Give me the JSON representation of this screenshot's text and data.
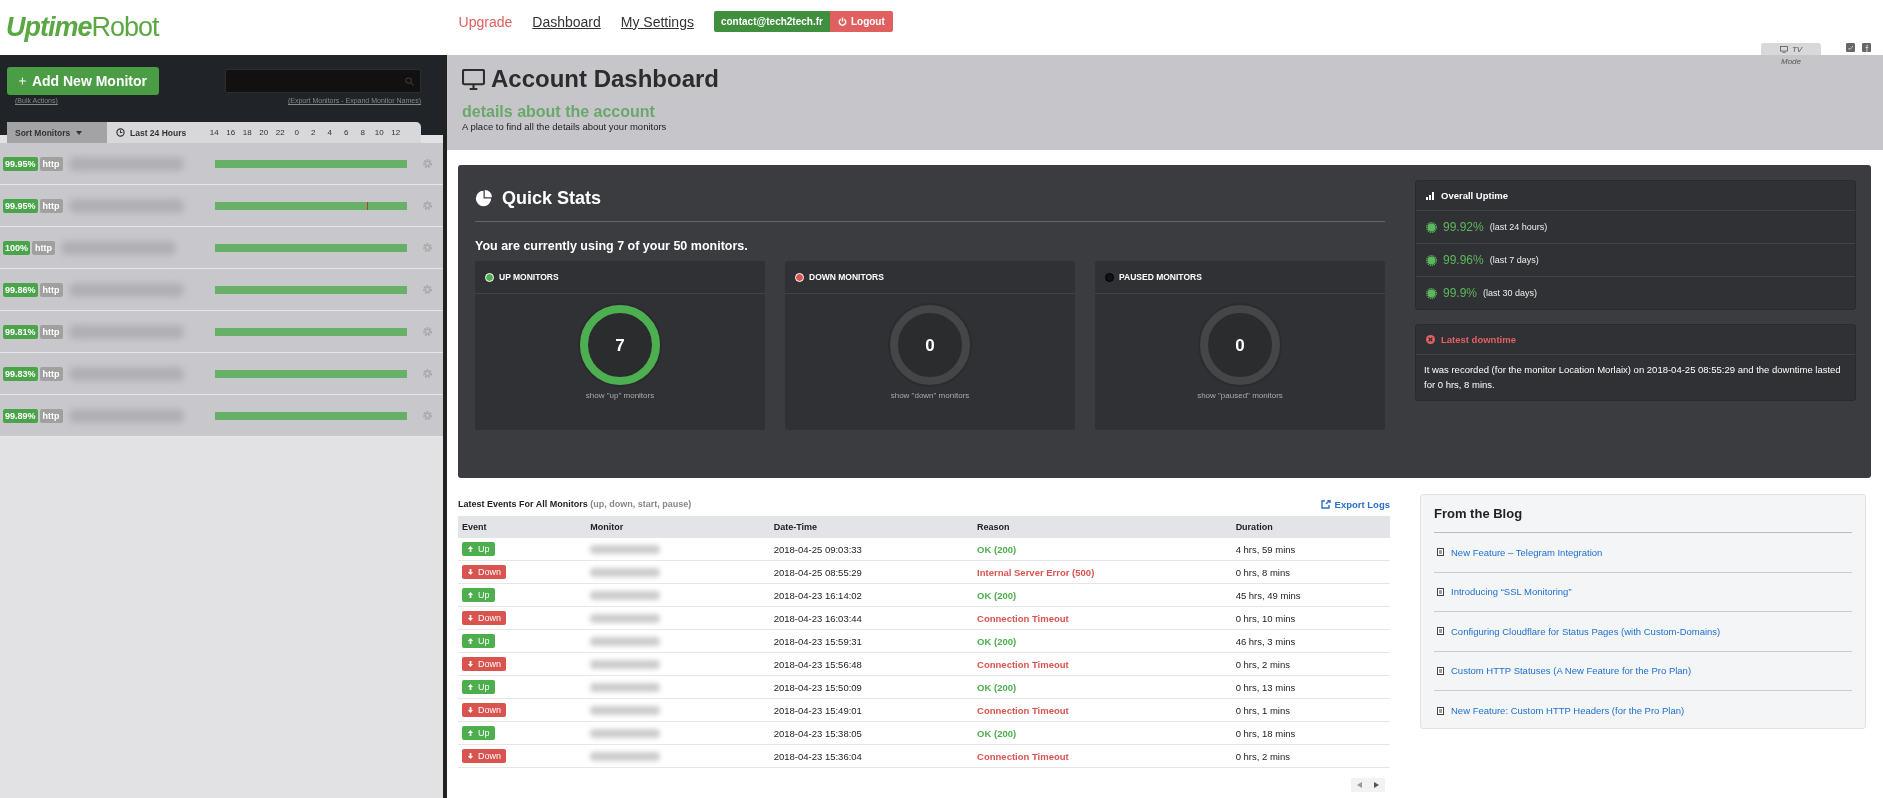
{
  "header": {
    "logo": "**Uptime**Robot",
    "nav": [
      {
        "label": "Upgrade",
        "kind": "upgrade"
      },
      {
        "label": "Dashboard",
        "kind": "link"
      },
      {
        "label": "My Settings",
        "kind": "link"
      }
    ],
    "account": "contact@tech2tech.fr",
    "logout": "Logout"
  },
  "sidebar": {
    "add_button": "Add New Monitor",
    "bulk_actions": "(Bulk Actions)",
    "monitor_links": "(Export Monitors - Expand Monitor Names)",
    "sort": "Sort Monitors",
    "range": "Last 24 Hours",
    "hours": [
      "14",
      "16",
      "18",
      "20",
      "22",
      "0",
      "2",
      "4",
      "6",
      "8",
      "10",
      "12"
    ],
    "monitors": [
      {
        "uptime": "99.95%",
        "type": "http",
        "incident": false
      },
      {
        "uptime": "99.95%",
        "type": "http",
        "incident": true
      },
      {
        "uptime": "100%",
        "type": "http",
        "incident": false
      },
      {
        "uptime": "99.86%",
        "type": "http",
        "incident": false
      },
      {
        "uptime": "99.81%",
        "type": "http",
        "incident": false
      },
      {
        "uptime": "99.83%",
        "type": "http",
        "incident": false
      },
      {
        "uptime": "99.89%",
        "type": "http",
        "incident": false
      }
    ]
  },
  "dashboard": {
    "title": "Account Dashboard",
    "subtitle": "details about the account",
    "tagline": "A place to find all the details about your monitors",
    "tv_label": "TV",
    "tv_sub": "Mode"
  },
  "quick_stats": {
    "title": "Quick Stats",
    "usage": "You are currently using 7 of your 50 monitors.",
    "boxes": [
      {
        "kind": "up",
        "label": "UP MONITORS",
        "count": "7",
        "link": "show \"up\" monitors"
      },
      {
        "kind": "down",
        "label": "DOWN MONITORS",
        "count": "0",
        "link": "show \"down\" monitors"
      },
      {
        "kind": "paused",
        "label": "PAUSED MONITORS",
        "count": "0",
        "link": "show \"paused\" monitors"
      }
    ]
  },
  "overall_uptime": {
    "title": "Overall Uptime",
    "rows": [
      {
        "value": "99.92%",
        "period": "(last 24 hours)"
      },
      {
        "value": "99.96%",
        "period": "(last 7 days)"
      },
      {
        "value": "99.9%",
        "period": "(last 30 days)"
      }
    ]
  },
  "latest_downtime": {
    "title": "Latest downtime",
    "text": "It was recorded (for the monitor Location Morlaix) on 2018-04-25 08:55:29 and the downtime lasted for 0 hrs, 8 mins."
  },
  "events": {
    "title": "Latest Events For All Monitors",
    "hint": "(up, down, start, pause)",
    "export": "Export Logs",
    "columns": [
      "Event",
      "Monitor",
      "Date-Time",
      "Reason",
      "Duration"
    ],
    "rows": [
      {
        "kind": "up",
        "event": "Up",
        "datetime": "2018-04-25 09:03:33",
        "reason": "OK (200)",
        "duration": "4 hrs, 59 mins"
      },
      {
        "kind": "down",
        "event": "Down",
        "datetime": "2018-04-25 08:55:29",
        "reason": "Internal Server Error (500)",
        "duration": "0 hrs, 8 mins"
      },
      {
        "kind": "up",
        "event": "Up",
        "datetime": "2018-04-23 16:14:02",
        "reason": "OK (200)",
        "duration": "45 hrs, 49 mins"
      },
      {
        "kind": "down",
        "event": "Down",
        "datetime": "2018-04-23 16:03:44",
        "reason": "Connection Timeout",
        "duration": "0 hrs, 10 mins"
      },
      {
        "kind": "up",
        "event": "Up",
        "datetime": "2018-04-23 15:59:31",
        "reason": "OK (200)",
        "duration": "46 hrs, 3 mins"
      },
      {
        "kind": "down",
        "event": "Down",
        "datetime": "2018-04-23 15:56:48",
        "reason": "Connection Timeout",
        "duration": "0 hrs, 2 mins"
      },
      {
        "kind": "up",
        "event": "Up",
        "datetime": "2018-04-23 15:50:09",
        "reason": "OK (200)",
        "duration": "0 hrs, 13 mins"
      },
      {
        "kind": "down",
        "event": "Down",
        "datetime": "2018-04-23 15:49:01",
        "reason": "Connection Timeout",
        "duration": "0 hrs, 1 mins"
      },
      {
        "kind": "up",
        "event": "Up",
        "datetime": "2018-04-23 15:38:05",
        "reason": "OK (200)",
        "duration": "0 hrs, 18 mins"
      },
      {
        "kind": "down",
        "event": "Down",
        "datetime": "2018-04-23 15:36:04",
        "reason": "Connection Timeout",
        "duration": "0 hrs, 2 mins"
      }
    ]
  },
  "blog": {
    "title": "From the Blog",
    "posts": [
      "New Feature – Telegram Integration",
      "Introducing “SSL Monitoring”",
      "Configuring Cloudflare for Status Pages (with Custom-Domains)",
      "Custom HTTP Statuses (A New Feature for the Pro Plan)",
      "New Feature: Custom HTTP Headers (for the Pro Plan)"
    ]
  }
}
